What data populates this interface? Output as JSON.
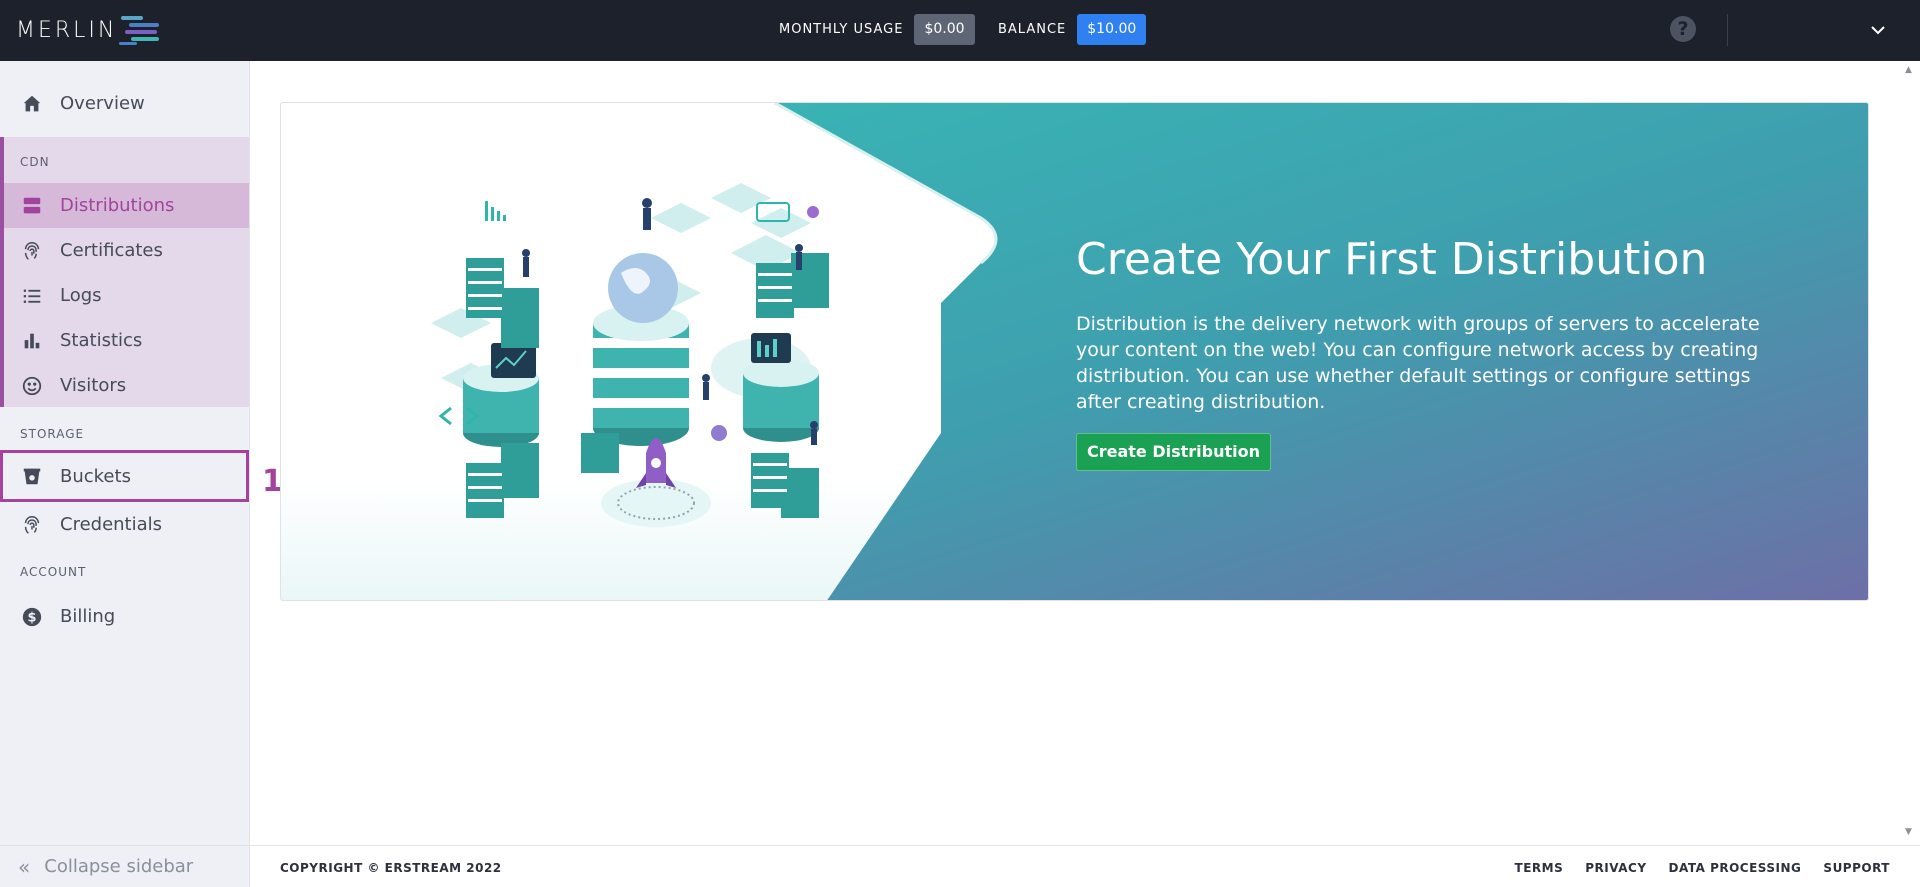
{
  "header": {
    "logo_text": "MERLIN",
    "monthly_usage_label": "MONTHLY USAGE",
    "monthly_usage_value": "$0.00",
    "balance_label": "BALANCE",
    "balance_value": "$10.00",
    "help_icon": "question-circle-icon",
    "user_menu_icon": "chevron-down-icon"
  },
  "sidebar": {
    "overview": "Overview",
    "cdn_section": "CDN",
    "distributions": "Distributions",
    "certificates": "Certificates",
    "logs": "Logs",
    "statistics": "Statistics",
    "visitors": "Visitors",
    "storage_section": "STORAGE",
    "buckets": "Buckets",
    "credentials": "Credentials",
    "account_section": "ACCOUNT",
    "billing": "Billing",
    "collapse": "Collapse sidebar",
    "annotation_number": "1"
  },
  "hero": {
    "title": "Create Your First Distribution",
    "description": "Distribution is the delivery network with groups of servers to accelerate your content on the web! You can configure network access by creating distribution. You can use whether default settings or configure settings after creating distribution.",
    "button": "Create Distribution"
  },
  "footer": {
    "copyright": "COPYRIGHT © ERSTREAM 2022",
    "links": [
      "TERMS",
      "PRIVACY",
      "DATA PROCESSING",
      "SUPPORT"
    ]
  },
  "colors": {
    "topbar": "#1d212b",
    "accent": "#a0449c",
    "balance_badge": "#2f80f0",
    "cta": "#1aa153",
    "banner_teal": "#35b8b4",
    "banner_purple": "#6d6fa6"
  }
}
